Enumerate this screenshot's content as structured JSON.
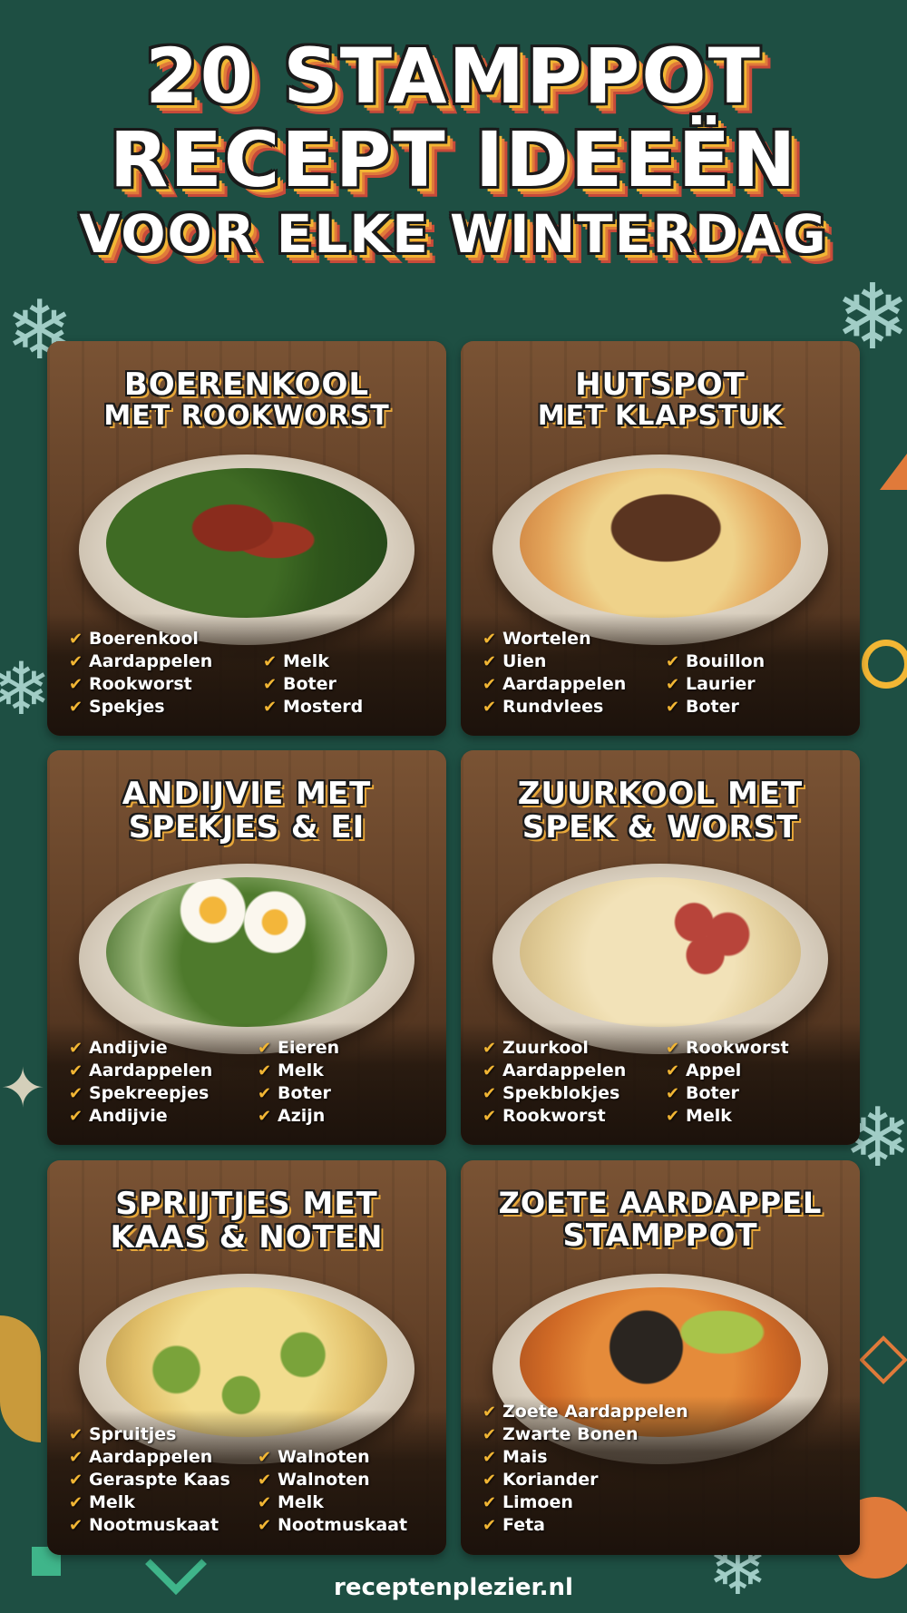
{
  "title": {
    "line1": "20 STAMPPOT",
    "line2": "RECEPT IDEEËN",
    "line3": "VOOR ELKE WINTERDAG"
  },
  "cards": [
    {
      "title_lines": [
        "BOERENKOOL",
        "MET ROOKWORST"
      ],
      "col1": [
        "Boerenkool",
        "Aardappelen",
        "Rookworst",
        "Spekjes"
      ],
      "col2": [
        "Melk",
        "Boter",
        "Mosterd"
      ]
    },
    {
      "title_lines": [
        "HUTSPOT",
        "MET KLAPSTUK"
      ],
      "col1": [
        "Wortelen",
        "Uien",
        "Aardappelen",
        "Rundvlees"
      ],
      "col2": [
        "Bouillon",
        "Laurier",
        "Boter"
      ]
    },
    {
      "title_lines": [
        "ANDIJVIE MET",
        "SPEKJES & EI"
      ],
      "col1": [
        "Andijvie",
        "Aardappelen",
        "Spekreepjes",
        "Andijvie"
      ],
      "col2": [
        "Eieren",
        "Melk",
        "Boter",
        "Azijn"
      ]
    },
    {
      "title_lines": [
        "ZUURKOOL MET",
        "SPEK & WORST"
      ],
      "col1": [
        "Zuurkool",
        "Aardappelen",
        "Spekblokjes",
        "Rookworst"
      ],
      "col2": [
        "Rookworst",
        "Appel",
        "Boter",
        "Melk"
      ]
    },
    {
      "title_lines": [
        "SPRIJTJES MET",
        "KAAS & NOTEN"
      ],
      "col1": [
        "Spruitjes",
        "Aardappelen",
        "Geraspte Kaas",
        "Melk",
        "Nootmuskaat"
      ],
      "col2": [
        "Walnoten",
        "Walnoten",
        "Melk",
        "Nootmuskaat"
      ]
    },
    {
      "title_lines": [
        "ZOETE AARDAPPEL",
        "STAMPPOT"
      ],
      "col1": [
        "Zoete Aardappelen",
        "Zwarte Bonen",
        "Mais",
        "Koriander",
        "Limoen",
        "Feta"
      ],
      "col2": []
    }
  ],
  "footer": "receptenplezier.nl",
  "colors": {
    "background": "#1e4f43",
    "accent_yellow": "#f2b634",
    "accent_orange": "#e07a3a",
    "accent_red": "#c74a3a"
  }
}
